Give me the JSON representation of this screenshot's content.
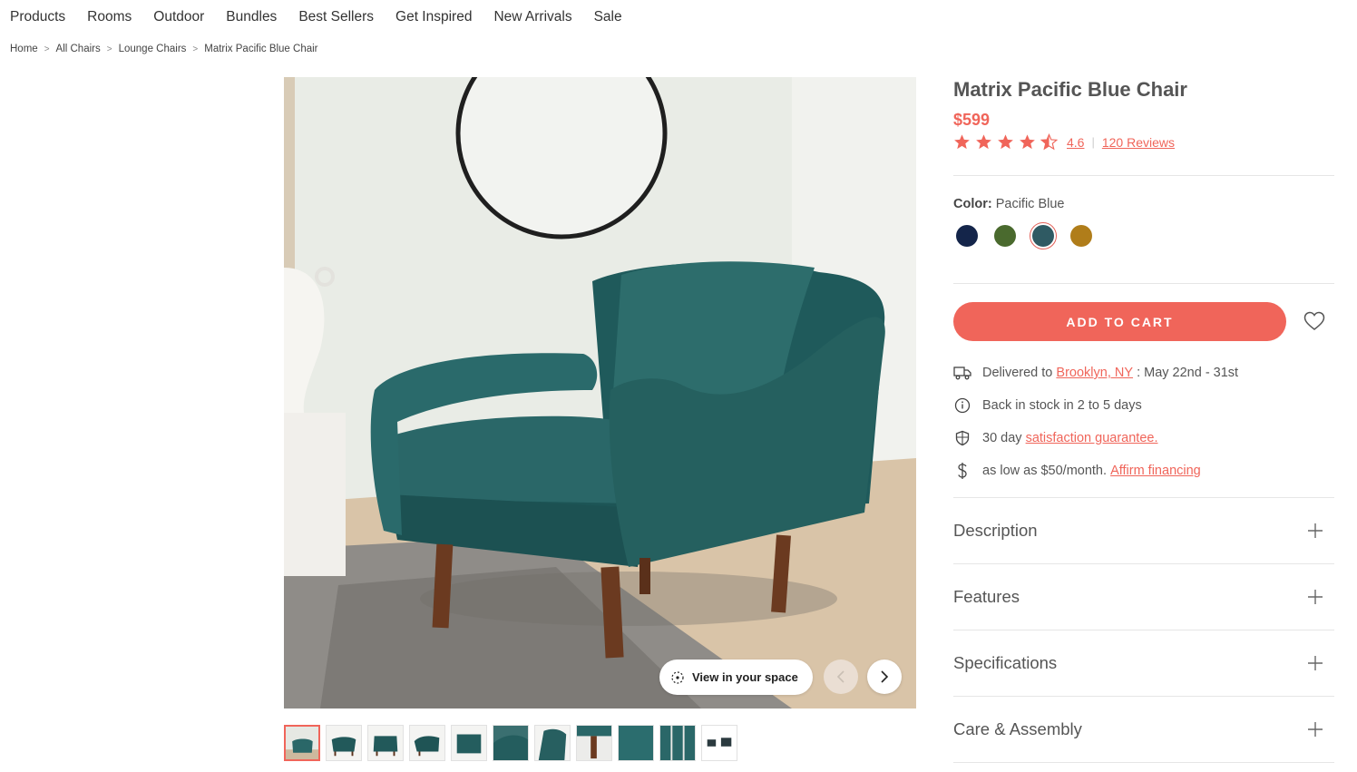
{
  "nav": {
    "items": [
      "Products",
      "Rooms",
      "Outdoor",
      "Bundles",
      "Best Sellers",
      "Get Inspired",
      "New Arrivals",
      "Sale"
    ]
  },
  "breadcrumb": {
    "items": [
      "Home",
      "All Chairs",
      "Lounge Chairs",
      "Matrix Pacific Blue Chair"
    ],
    "separator": ">"
  },
  "gallery": {
    "view_in_space_label": "View in your space",
    "thumbnail_count": 11,
    "active_thumbnail": 1,
    "prev_icon": "chevron-left-icon",
    "next_icon": "chevron-right-icon"
  },
  "product": {
    "title": "Matrix Pacific Blue Chair",
    "price": "$599",
    "rating_value": "4.6",
    "rating_stars": 4.5,
    "rating_divider": "|",
    "reviews_label": "120 Reviews",
    "color_label": "Color:",
    "color_value": "Pacific Blue",
    "swatches": [
      {
        "name": "navy",
        "color": "#14254a"
      },
      {
        "name": "olive",
        "color": "#4a6a2e"
      },
      {
        "name": "pacific-blue",
        "color": "#2f5a63",
        "selected": true
      },
      {
        "name": "ochre",
        "color": "#b07d1a"
      }
    ],
    "add_to_cart_label": "ADD TO CART"
  },
  "info": {
    "delivery_prefix": "Delivered to",
    "delivery_location": "Brooklyn, NY",
    "delivery_dates": ": May 22nd - 31st",
    "stock": "Back in stock in 2 to 5 days",
    "guarantee_prefix": "30 day",
    "guarantee_link": "satisfaction guarantee.",
    "financing_prefix": "as low as $50/month.",
    "financing_link": "Affirm financing"
  },
  "accordions": [
    "Description",
    "Features",
    "Specifications",
    "Care & Assembly"
  ],
  "colors": {
    "accent": "#f0655a",
    "text": "#555555",
    "divider": "#e6e6e6"
  }
}
